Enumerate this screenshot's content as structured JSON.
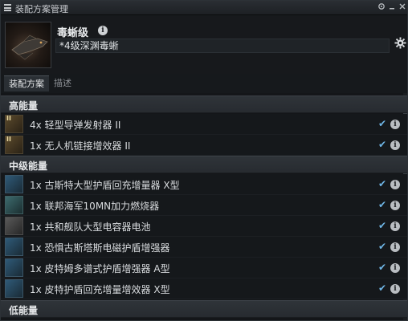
{
  "window": {
    "title": "装配方案管理",
    "controls": {
      "pin_icon": "pin-icon",
      "minimize_icon": "minimize-icon",
      "close_icon": "close-icon"
    }
  },
  "ship": {
    "name": "毒蜥级",
    "fitting_name": "*4级深渊毒蜥"
  },
  "tabs": [
    {
      "label": "装配方案",
      "active": true
    },
    {
      "label": "描述",
      "active": false
    }
  ],
  "groups": [
    {
      "title": "高能量",
      "modules": [
        {
          "label": "4x 轻型导弹发射器 II",
          "icon": "launcher-icon",
          "tier": "II"
        },
        {
          "label": "1x 无人机链接增效器 II",
          "icon": "drone-link-icon",
          "tier": "II"
        }
      ]
    },
    {
      "title": "中级能量",
      "modules": [
        {
          "label": "1x 古斯特大型护盾回充增量器 X型",
          "icon": "shield-booster-icon",
          "tier": ""
        },
        {
          "label": "1x 联邦海军10MN加力燃烧器",
          "icon": "afterburner-icon",
          "tier": ""
        },
        {
          "label": "1x 共和舰队大型电容器电池",
          "icon": "cap-battery-icon",
          "tier": ""
        },
        {
          "label": "1x 恐惧古斯塔斯电磁护盾增强器",
          "icon": "shield-hardener-icon",
          "tier": ""
        },
        {
          "label": "1x 皮特姆多谱式护盾增强器 A型",
          "icon": "shield-hardener-icon",
          "tier": ""
        },
        {
          "label": "1x 皮特护盾回充增量增效器 X型",
          "icon": "shield-booster-icon",
          "tier": ""
        }
      ]
    },
    {
      "title": "低能量",
      "modules": []
    }
  ],
  "colors": {
    "check": "#6fb6e6",
    "background": "#16191c",
    "header": "#2b3035"
  }
}
